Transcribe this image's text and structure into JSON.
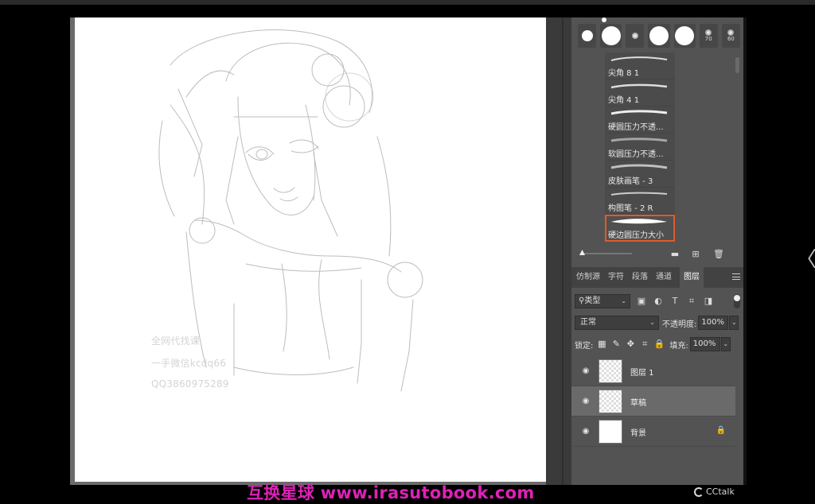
{
  "canvas": {
    "watermark_lines": [
      "全网代找课",
      "一手微信kcdq66",
      "QQ3860975289"
    ]
  },
  "brushes": {
    "tips": [
      {
        "icon": "hard-round-tip",
        "size": ""
      },
      {
        "icon": "hard-round-large-tip",
        "size": ""
      },
      {
        "icon": "soft-round-tip",
        "size": ""
      },
      {
        "icon": "hard-round-large-tip",
        "size": ""
      },
      {
        "icon": "hard-round-large-tip",
        "size": ""
      },
      {
        "icon": "soft-dot-tip",
        "size": "70"
      },
      {
        "icon": "soft-dot-tip",
        "size": "60"
      }
    ],
    "items": [
      {
        "label": "尖角 8 1"
      },
      {
        "label": "尖角 4 1"
      },
      {
        "label": "硬圆压力不透..."
      },
      {
        "label": "软圆压力不透..."
      },
      {
        "label": "皮肤画笔 - 3"
      },
      {
        "label": "构图笔 - 2 R"
      },
      {
        "label": "硬边圆压力大小"
      }
    ],
    "selected_index": 6
  },
  "tabs": [
    "仿制源",
    "字符",
    "段落",
    "通道",
    "图层"
  ],
  "active_tab": "图层",
  "filter": {
    "kind": "类型"
  },
  "blend": {
    "mode": "正常",
    "opacity_label": "不透明度:",
    "opacity": "100%"
  },
  "lock": {
    "label": "锁定:",
    "fill_label": "填充:",
    "fill": "100%"
  },
  "layers": [
    {
      "name": "图层 1",
      "thumb": "transparent",
      "selected": false,
      "locked": false
    },
    {
      "name": "草稿",
      "thumb": "transparent",
      "selected": true,
      "locked": false
    },
    {
      "name": "背景",
      "thumb": "white",
      "selected": false,
      "locked": true
    }
  ],
  "overlay": {
    "site": "互换星球 www.irasutobook.com",
    "brand": "CCtalk"
  },
  "colors": {
    "selection_outline": "#e05a2a",
    "site_watermark": "#e020b8"
  }
}
